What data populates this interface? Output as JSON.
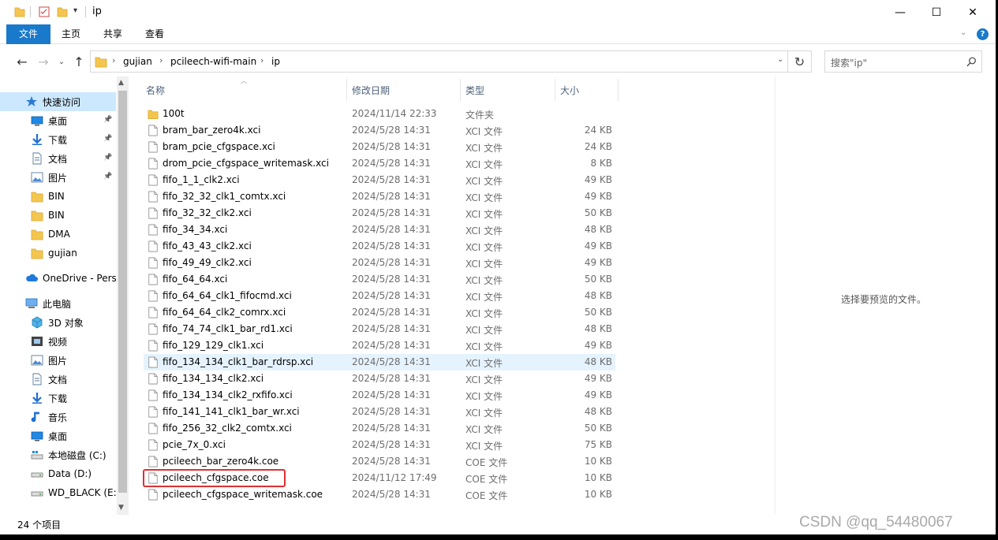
{
  "window": {
    "title": "ip",
    "minimize_glyph": "—",
    "maximize_glyph": "☐",
    "close_glyph": "✕"
  },
  "ribbon": {
    "tabs": [
      {
        "label": "文件",
        "active": true
      },
      {
        "label": "主页",
        "active": false
      },
      {
        "label": "共享",
        "active": false
      },
      {
        "label": "查看",
        "active": false
      }
    ]
  },
  "address": {
    "crumbs": [
      "gujian",
      "pcileech-wifi-main",
      "ip"
    ]
  },
  "search": {
    "placeholder": "搜索\"ip\""
  },
  "nav": {
    "items": [
      {
        "label": "快速访问",
        "icon": "star-icon",
        "indent": 1,
        "selected": true,
        "pinned": false
      },
      {
        "label": "桌面",
        "icon": "desktop-icon",
        "indent": 2,
        "pinned": true
      },
      {
        "label": "下载",
        "icon": "download-icon",
        "indent": 2,
        "pinned": true
      },
      {
        "label": "文档",
        "icon": "document-icon",
        "indent": 2,
        "pinned": true
      },
      {
        "label": "图片",
        "icon": "pictures-icon",
        "indent": 2,
        "pinned": true
      },
      {
        "label": "BIN",
        "icon": "folder-icon",
        "indent": 2,
        "pinned": false
      },
      {
        "label": "BIN",
        "icon": "folder-icon",
        "indent": 2,
        "pinned": false
      },
      {
        "label": "DMA",
        "icon": "folder-icon",
        "indent": 2,
        "pinned": false
      },
      {
        "label": "gujian",
        "icon": "folder-icon",
        "indent": 2,
        "pinned": false
      },
      {
        "label": "OneDrive - Perso",
        "icon": "cloud-icon",
        "indent": 1,
        "pinned": false,
        "gap": true
      },
      {
        "label": "此电脑",
        "icon": "computer-icon",
        "indent": 1,
        "pinned": false,
        "gap": true
      },
      {
        "label": "3D 对象",
        "icon": "3d-objects-icon",
        "indent": 2,
        "pinned": false
      },
      {
        "label": "视频",
        "icon": "video-icon",
        "indent": 2,
        "pinned": false
      },
      {
        "label": "图片",
        "icon": "pictures-icon",
        "indent": 2,
        "pinned": false
      },
      {
        "label": "文档",
        "icon": "document-icon",
        "indent": 2,
        "pinned": false
      },
      {
        "label": "下载",
        "icon": "download-icon",
        "indent": 2,
        "pinned": false
      },
      {
        "label": "音乐",
        "icon": "music-icon",
        "indent": 2,
        "pinned": false
      },
      {
        "label": "桌面",
        "icon": "desktop-icon",
        "indent": 2,
        "pinned": false
      },
      {
        "label": "本地磁盘 (C:)",
        "icon": "system-drive-icon",
        "indent": 2,
        "pinned": false
      },
      {
        "label": "Data (D:)",
        "icon": "drive-icon",
        "indent": 2,
        "pinned": false
      },
      {
        "label": "WD_BLACK (E:)",
        "icon": "drive-icon",
        "indent": 2,
        "pinned": false
      }
    ]
  },
  "columns": {
    "name": "名称",
    "date": "修改日期",
    "type": "类型",
    "size": "大小"
  },
  "files": [
    {
      "name": "100t",
      "date": "2024/11/14 22:33",
      "type": "文件夹",
      "size": "",
      "icon": "folder-icon"
    },
    {
      "name": "bram_bar_zero4k.xci",
      "date": "2024/5/28 14:31",
      "type": "XCI 文件",
      "size": "24 KB",
      "icon": "file-icon"
    },
    {
      "name": "bram_pcie_cfgspace.xci",
      "date": "2024/5/28 14:31",
      "type": "XCI 文件",
      "size": "24 KB",
      "icon": "file-icon"
    },
    {
      "name": "drom_pcie_cfgspace_writemask.xci",
      "date": "2024/5/28 14:31",
      "type": "XCI 文件",
      "size": "8 KB",
      "icon": "file-icon"
    },
    {
      "name": "fifo_1_1_clk2.xci",
      "date": "2024/5/28 14:31",
      "type": "XCI 文件",
      "size": "49 KB",
      "icon": "file-icon"
    },
    {
      "name": "fifo_32_32_clk1_comtx.xci",
      "date": "2024/5/28 14:31",
      "type": "XCI 文件",
      "size": "49 KB",
      "icon": "file-icon"
    },
    {
      "name": "fifo_32_32_clk2.xci",
      "date": "2024/5/28 14:31",
      "type": "XCI 文件",
      "size": "50 KB",
      "icon": "file-icon"
    },
    {
      "name": "fifo_34_34.xci",
      "date": "2024/5/28 14:31",
      "type": "XCI 文件",
      "size": "48 KB",
      "icon": "file-icon"
    },
    {
      "name": "fifo_43_43_clk2.xci",
      "date": "2024/5/28 14:31",
      "type": "XCI 文件",
      "size": "49 KB",
      "icon": "file-icon"
    },
    {
      "name": "fifo_49_49_clk2.xci",
      "date": "2024/5/28 14:31",
      "type": "XCI 文件",
      "size": "49 KB",
      "icon": "file-icon"
    },
    {
      "name": "fifo_64_64.xci",
      "date": "2024/5/28 14:31",
      "type": "XCI 文件",
      "size": "50 KB",
      "icon": "file-icon"
    },
    {
      "name": "fifo_64_64_clk1_fifocmd.xci",
      "date": "2024/5/28 14:31",
      "type": "XCI 文件",
      "size": "48 KB",
      "icon": "file-icon"
    },
    {
      "name": "fifo_64_64_clk2_comrx.xci",
      "date": "2024/5/28 14:31",
      "type": "XCI 文件",
      "size": "50 KB",
      "icon": "file-icon"
    },
    {
      "name": "fifo_74_74_clk1_bar_rd1.xci",
      "date": "2024/5/28 14:31",
      "type": "XCI 文件",
      "size": "48 KB",
      "icon": "file-icon"
    },
    {
      "name": "fifo_129_129_clk1.xci",
      "date": "2024/5/28 14:31",
      "type": "XCI 文件",
      "size": "49 KB",
      "icon": "file-icon"
    },
    {
      "name": "fifo_134_134_clk1_bar_rdrsp.xci",
      "date": "2024/5/28 14:31",
      "type": "XCI 文件",
      "size": "48 KB",
      "icon": "file-icon",
      "hover": true
    },
    {
      "name": "fifo_134_134_clk2.xci",
      "date": "2024/5/28 14:31",
      "type": "XCI 文件",
      "size": "49 KB",
      "icon": "file-icon"
    },
    {
      "name": "fifo_134_134_clk2_rxfifo.xci",
      "date": "2024/5/28 14:31",
      "type": "XCI 文件",
      "size": "49 KB",
      "icon": "file-icon"
    },
    {
      "name": "fifo_141_141_clk1_bar_wr.xci",
      "date": "2024/5/28 14:31",
      "type": "XCI 文件",
      "size": "48 KB",
      "icon": "file-icon"
    },
    {
      "name": "fifo_256_32_clk2_comtx.xci",
      "date": "2024/5/28 14:31",
      "type": "XCI 文件",
      "size": "50 KB",
      "icon": "file-icon"
    },
    {
      "name": "pcie_7x_0.xci",
      "date": "2024/5/28 14:31",
      "type": "XCI 文件",
      "size": "75 KB",
      "icon": "file-icon"
    },
    {
      "name": "pcileech_bar_zero4k.coe",
      "date": "2024/5/28 14:31",
      "type": "COE 文件",
      "size": "10 KB",
      "icon": "file-icon"
    },
    {
      "name": "pcileech_cfgspace.coe",
      "date": "2024/11/12 17:49",
      "type": "COE 文件",
      "size": "10 KB",
      "icon": "file-icon",
      "highlighted": true
    },
    {
      "name": "pcileech_cfgspace_writemask.coe",
      "date": "2024/5/28 14:31",
      "type": "COE 文件",
      "size": "10 KB",
      "icon": "file-icon"
    }
  ],
  "preview": {
    "empty_text": "选择要预览的文件。"
  },
  "status": {
    "item_count": "24 个项目"
  },
  "watermark": "CSDN @qq_54480067",
  "colors": {
    "accent": "#1979ca",
    "selection": "#cce8ff",
    "hover": "#e5f3ff",
    "annotation": "#e03030",
    "folder": "#f5c64f"
  }
}
